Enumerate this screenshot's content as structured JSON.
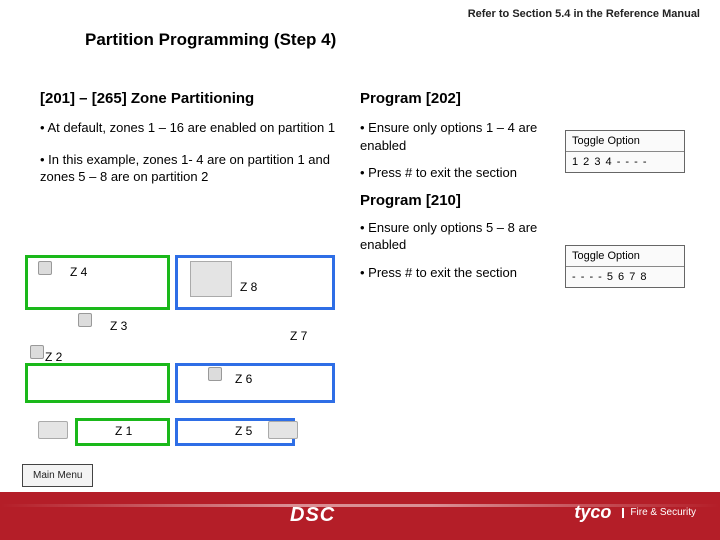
{
  "refer": "Refer to Section 5.4 in the Reference Manual",
  "title": "Partition Programming (Step 4)",
  "left": {
    "header": "[201] – [265] Zone Partitioning",
    "b1": "• At default, zones 1 – 16 are enabled on partition 1",
    "b2": "• In this example, zones 1- 4 are on partition 1 and zones 5 – 8 are on partition 2"
  },
  "right": {
    "h1": "Program [202]",
    "b1": "• Ensure only options 1 – 4 are enabled",
    "b2": "• Press # to exit the section",
    "h2": "Program [210]",
    "b3": "• Ensure only options 5 – 8 are enabled",
    "b4": "• Press # to exit the section"
  },
  "opt": {
    "label": "Toggle Option",
    "v1": "1 2 3 4 - - - -",
    "v2": "- - - - 5 6 7 8"
  },
  "zones": {
    "z1": "Z 1",
    "z2": "Z 2",
    "z3": "Z 3",
    "z4": "Z 4",
    "z5": "Z 5",
    "z6": "Z 6",
    "z7": "Z 7",
    "z8": "Z 8"
  },
  "menu": "Main Menu",
  "brand": {
    "dsc": "DSC",
    "tyco": "tyco",
    "sub": "Fire &\nSecurity"
  }
}
